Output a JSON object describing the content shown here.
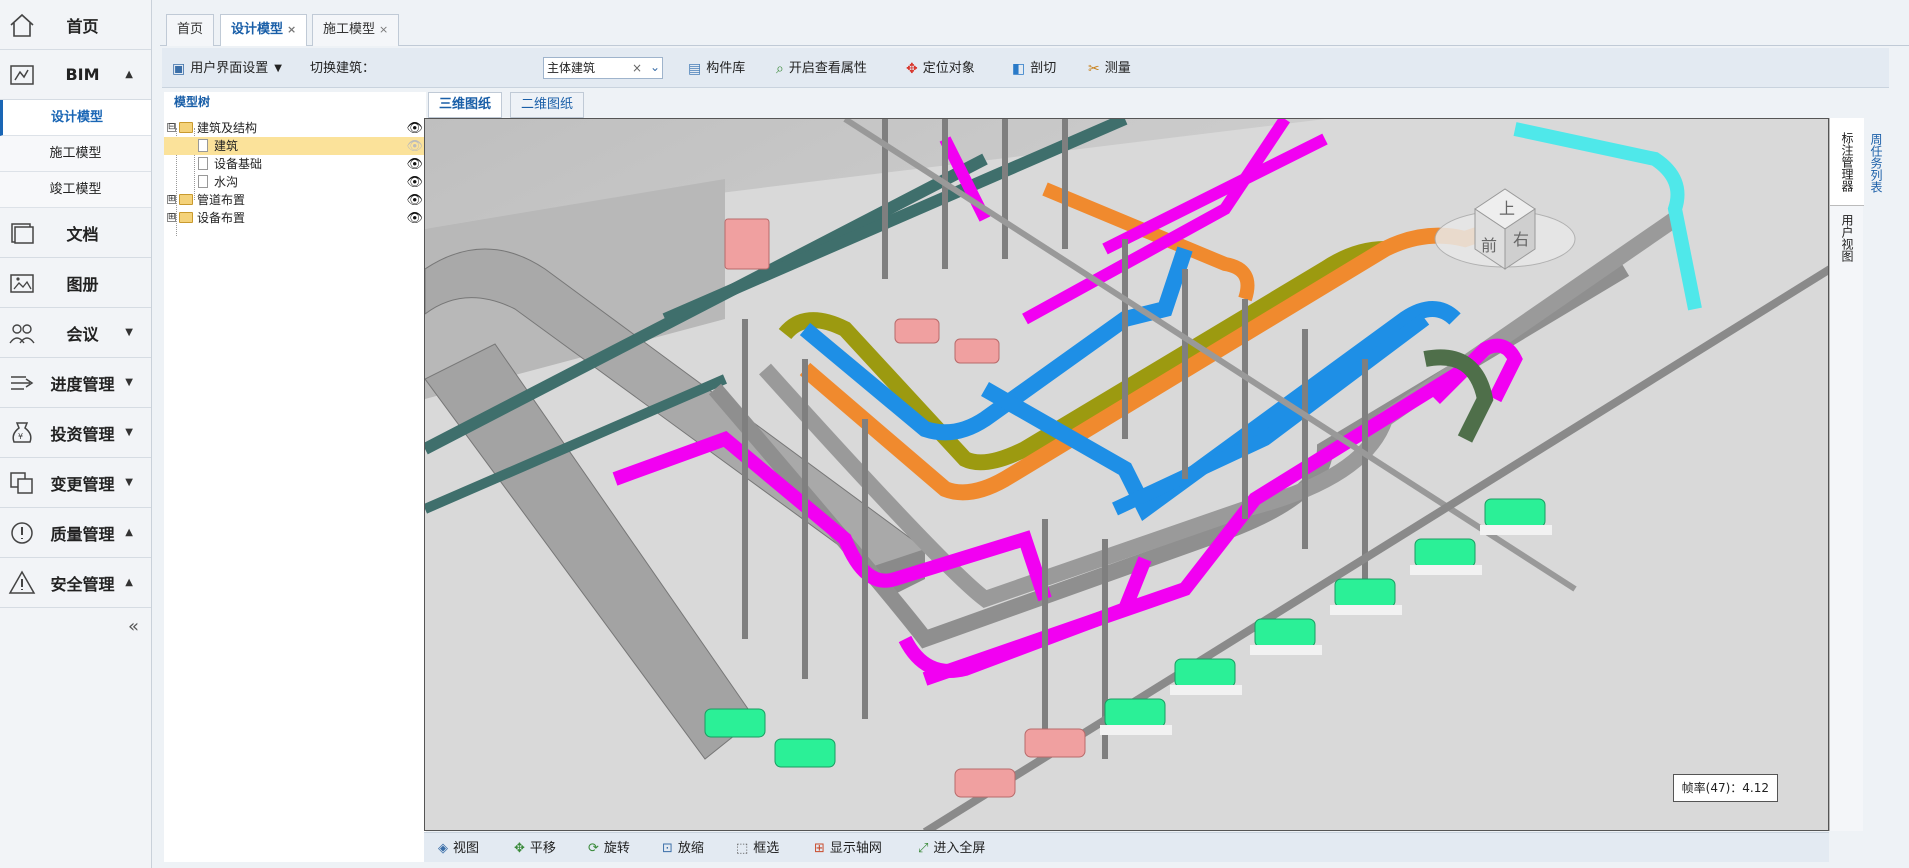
{
  "sidebar": {
    "items": [
      {
        "label": "首页",
        "icon": "home-icon"
      },
      {
        "label": "BIM",
        "icon": "bim-icon",
        "arrow": "▲"
      },
      {
        "label": "文档",
        "icon": "document-icon"
      },
      {
        "label": "图册",
        "icon": "album-icon"
      },
      {
        "label": "会议",
        "icon": "meeting-icon",
        "arrow": "▼"
      },
      {
        "label": "进度管理",
        "icon": "progress-icon",
        "arrow": "▼"
      },
      {
        "label": "投资管理",
        "icon": "investment-icon",
        "arrow": "▼"
      },
      {
        "label": "变更管理",
        "icon": "change-icon",
        "arrow": "▼"
      },
      {
        "label": "质量管理",
        "icon": "quality-icon",
        "arrow": "▲"
      },
      {
        "label": "安全管理",
        "icon": "safety-icon",
        "arrow": "▲"
      }
    ],
    "bim_sub": [
      "设计模型",
      "施工模型",
      "竣工模型"
    ],
    "collapse_glyph": "«"
  },
  "tabs": [
    {
      "label": "首页",
      "closable": false
    },
    {
      "label": "设计模型",
      "closable": true
    },
    {
      "label": "施工模型",
      "closable": true
    }
  ],
  "tab_close": "×",
  "toolbar": {
    "ui_settings": "用户界面设置",
    "switch_label": "切换建筑：",
    "building_value": "主体建筑",
    "clear": "×",
    "dropdown": "⌄",
    "library": "构件库",
    "properties": "开启查看属性",
    "locate": "定位对象",
    "section": "剖切",
    "measure": "测量"
  },
  "tree": {
    "title": "模型树",
    "nodes": [
      {
        "label": "建筑及结构",
        "expander": "⊟"
      },
      {
        "label": "建筑"
      },
      {
        "label": "设备基础"
      },
      {
        "label": "水沟"
      },
      {
        "label": "管道布置",
        "expander": "⊞"
      },
      {
        "label": "设备布置",
        "expander": "⊞"
      }
    ],
    "eye": "👁"
  },
  "drawing_tabs": [
    "三维图纸",
    "二维图纸"
  ],
  "viewport": {
    "fps_text": "帧率(47)：4.12",
    "cube": {
      "top": "上",
      "front": "前",
      "right": "右"
    }
  },
  "right_tabs": [
    "标注管理器",
    "用户视图"
  ],
  "far_right_tab": "周任务列表",
  "bottom_toolbar": [
    "视图",
    "平移",
    "旋转",
    "放缩",
    "框选",
    "显示轴网",
    "进入全屏"
  ],
  "colors": {
    "accent": "#1a5fa8",
    "pipe_magenta": "#f200f2",
    "pipe_blue": "#1e8fe6",
    "pipe_orange": "#f08a2e",
    "pipe_olive": "#9c9a10",
    "pipe_teal": "#3f6f6c",
    "pump_green": "#2bf097",
    "pump_pink": "#f0a0a0"
  }
}
